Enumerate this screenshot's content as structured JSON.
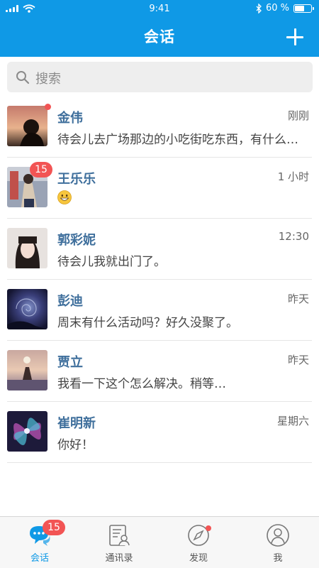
{
  "status_bar": {
    "time": "9:41",
    "battery": "60 %",
    "battery_level": 0.6
  },
  "header": {
    "title": "会话",
    "add_icon": "plus-icon"
  },
  "search": {
    "placeholder": "搜索",
    "icon": "search-icon"
  },
  "conversations": [
    {
      "name": "金伟",
      "time": "刚刚",
      "message": "待会儿去广场那边的小吃街吃东西，有什么想吃的吗？",
      "indicator": "dot"
    },
    {
      "name": "王乐乐",
      "time": "1 小时",
      "message": "",
      "emoji": "grinning-face-emoji",
      "badge": "15"
    },
    {
      "name": "郭彩妮",
      "time": "12:30",
      "message": "待会儿我就出门了。"
    },
    {
      "name": "彭迪",
      "time": "昨天",
      "message": "周末有什么活动吗？好久没聚了。"
    },
    {
      "name": "贾立",
      "time": "昨天",
      "message": "我看一下这个怎么解决。稍等…"
    },
    {
      "name": "崔明新",
      "time": "星期六",
      "message": "你好！"
    }
  ],
  "tabbar": {
    "tabs": [
      {
        "label": "会话",
        "icon": "chat-bubbles-icon",
        "badge": "15",
        "active": true
      },
      {
        "label": "通讯录",
        "icon": "contacts-icon"
      },
      {
        "label": "发现",
        "icon": "compass-icon",
        "indicator": "dot"
      },
      {
        "label": "我",
        "icon": "user-icon"
      }
    ]
  },
  "colors": {
    "brand": "#0f99e6",
    "badge": "#f25454",
    "name": "#3f6f9c"
  }
}
